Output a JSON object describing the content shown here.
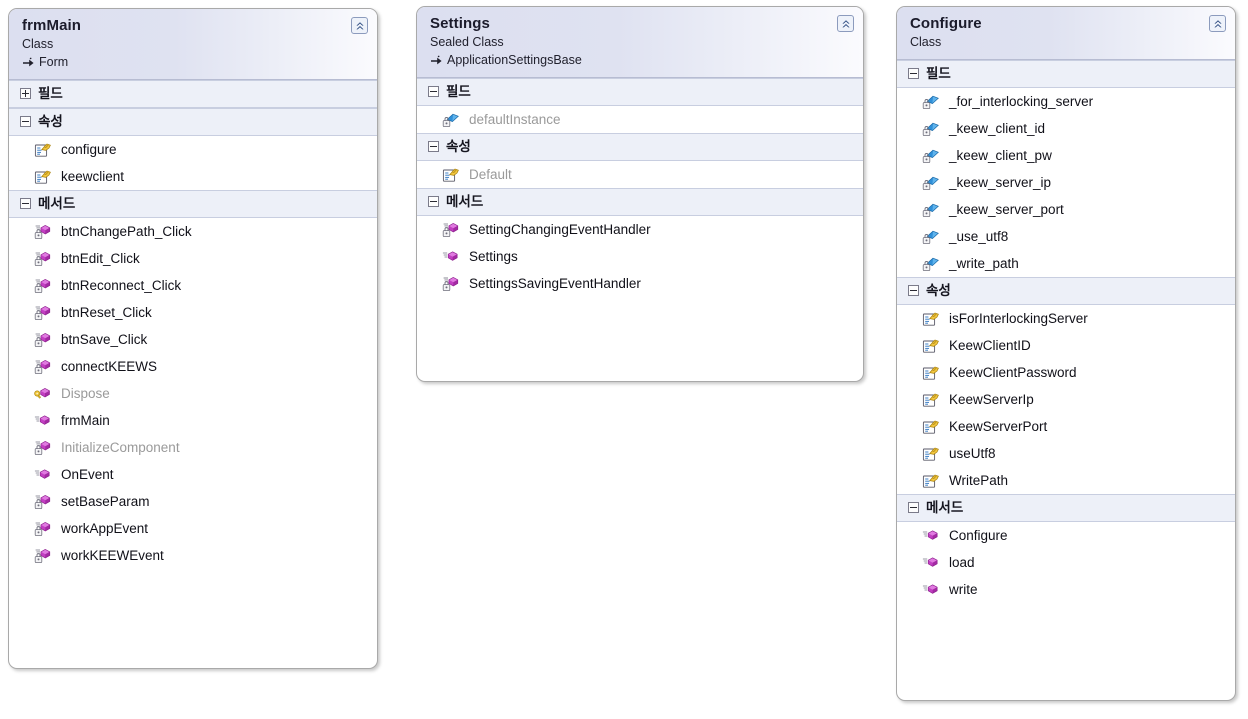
{
  "diagram": {
    "type": "uml-class-diagram",
    "background": "#ffffff",
    "icons": {
      "collapse": "chevron-double-up-icon",
      "inheritance": "inheritance-arrow-icon",
      "private_field": "private-field-icon",
      "private_method": "private-method-icon",
      "public_method": "public-method-icon",
      "protected_method": "protected-method-icon",
      "public_property": "public-property-icon"
    },
    "colors": {
      "header_gradient_start": "#dcdff0",
      "header_gradient_end": "#fbfbfe",
      "section_header_bg": "#edf0f8",
      "border": "#a9a9a9",
      "text": "#101018",
      "dim_text": "#9a9a9a",
      "field_icon": "#2f8fd8",
      "method_icon": "#c33fc3",
      "property_icon": "#e8b423"
    }
  },
  "classes": [
    {
      "id": "frmMain",
      "title": "frmMain",
      "stereotype": "Class",
      "base": "Form",
      "collapse_tooltip": "Collapse",
      "sections": [
        {
          "label": "필드",
          "expanded": false,
          "members": []
        },
        {
          "label": "속성",
          "expanded": true,
          "members": [
            {
              "name": "configure",
              "icon": "public-property-icon",
              "dim": false
            },
            {
              "name": "keewclient",
              "icon": "public-property-icon",
              "dim": false
            }
          ]
        },
        {
          "label": "메서드",
          "expanded": true,
          "members": [
            {
              "name": "btnChangePath_Click",
              "icon": "private-method-icon",
              "dim": false
            },
            {
              "name": "btnEdit_Click",
              "icon": "private-method-icon",
              "dim": false
            },
            {
              "name": "btnReconnect_Click",
              "icon": "private-method-icon",
              "dim": false
            },
            {
              "name": "btnReset_Click",
              "icon": "private-method-icon",
              "dim": false
            },
            {
              "name": "btnSave_Click",
              "icon": "private-method-icon",
              "dim": false
            },
            {
              "name": "connectKEEWS",
              "icon": "private-method-icon",
              "dim": false
            },
            {
              "name": "Dispose",
              "icon": "protected-method-icon",
              "dim": true
            },
            {
              "name": "frmMain",
              "icon": "public-method-icon",
              "dim": false
            },
            {
              "name": "InitializeComponent",
              "icon": "private-method-icon",
              "dim": true
            },
            {
              "name": "OnEvent",
              "icon": "public-method-icon",
              "dim": false
            },
            {
              "name": "setBaseParam",
              "icon": "private-method-icon",
              "dim": false
            },
            {
              "name": "workAppEvent",
              "icon": "private-method-icon",
              "dim": false
            },
            {
              "name": "workKEEWEvent",
              "icon": "private-method-icon",
              "dim": false
            }
          ]
        }
      ]
    },
    {
      "id": "Settings",
      "title": "Settings",
      "stereotype": "Sealed Class",
      "base": "ApplicationSettingsBase",
      "collapse_tooltip": "Collapse",
      "sections": [
        {
          "label": "필드",
          "expanded": true,
          "members": [
            {
              "name": "defaultInstance",
              "icon": "private-field-icon",
              "dim": true
            }
          ]
        },
        {
          "label": "속성",
          "expanded": true,
          "members": [
            {
              "name": "Default",
              "icon": "public-property-icon",
              "dim": true
            }
          ]
        },
        {
          "label": "메서드",
          "expanded": true,
          "members": [
            {
              "name": "SettingChangingEventHandler",
              "icon": "private-method-icon",
              "dim": false
            },
            {
              "name": "Settings",
              "icon": "public-method-icon",
              "dim": false
            },
            {
              "name": "SettingsSavingEventHandler",
              "icon": "private-method-icon",
              "dim": false
            }
          ]
        }
      ]
    },
    {
      "id": "Configure",
      "title": "Configure",
      "stereotype": "Class",
      "base": "",
      "collapse_tooltip": "Collapse",
      "sections": [
        {
          "label": "필드",
          "expanded": true,
          "members": [
            {
              "name": "_for_interlocking_server",
              "icon": "private-field-icon",
              "dim": false
            },
            {
              "name": "_keew_client_id",
              "icon": "private-field-icon",
              "dim": false
            },
            {
              "name": "_keew_client_pw",
              "icon": "private-field-icon",
              "dim": false
            },
            {
              "name": "_keew_server_ip",
              "icon": "private-field-icon",
              "dim": false
            },
            {
              "name": "_keew_server_port",
              "icon": "private-field-icon",
              "dim": false
            },
            {
              "name": "_use_utf8",
              "icon": "private-field-icon",
              "dim": false
            },
            {
              "name": "_write_path",
              "icon": "private-field-icon",
              "dim": false
            }
          ]
        },
        {
          "label": "속성",
          "expanded": true,
          "members": [
            {
              "name": "isForInterlockingServer",
              "icon": "public-property-icon",
              "dim": false
            },
            {
              "name": "KeewClientID",
              "icon": "public-property-icon",
              "dim": false
            },
            {
              "name": "KeewClientPassword",
              "icon": "public-property-icon",
              "dim": false
            },
            {
              "name": "KeewServerIp",
              "icon": "public-property-icon",
              "dim": false
            },
            {
              "name": "KeewServerPort",
              "icon": "public-property-icon",
              "dim": false
            },
            {
              "name": "useUtf8",
              "icon": "public-property-icon",
              "dim": false
            },
            {
              "name": "WritePath",
              "icon": "public-property-icon",
              "dim": false
            }
          ]
        },
        {
          "label": "메서드",
          "expanded": true,
          "members": [
            {
              "name": "Configure",
              "icon": "public-method-icon",
              "dim": false
            },
            {
              "name": "load",
              "icon": "public-method-icon",
              "dim": false
            },
            {
              "name": "write",
              "icon": "public-method-icon",
              "dim": false
            }
          ]
        }
      ]
    }
  ]
}
